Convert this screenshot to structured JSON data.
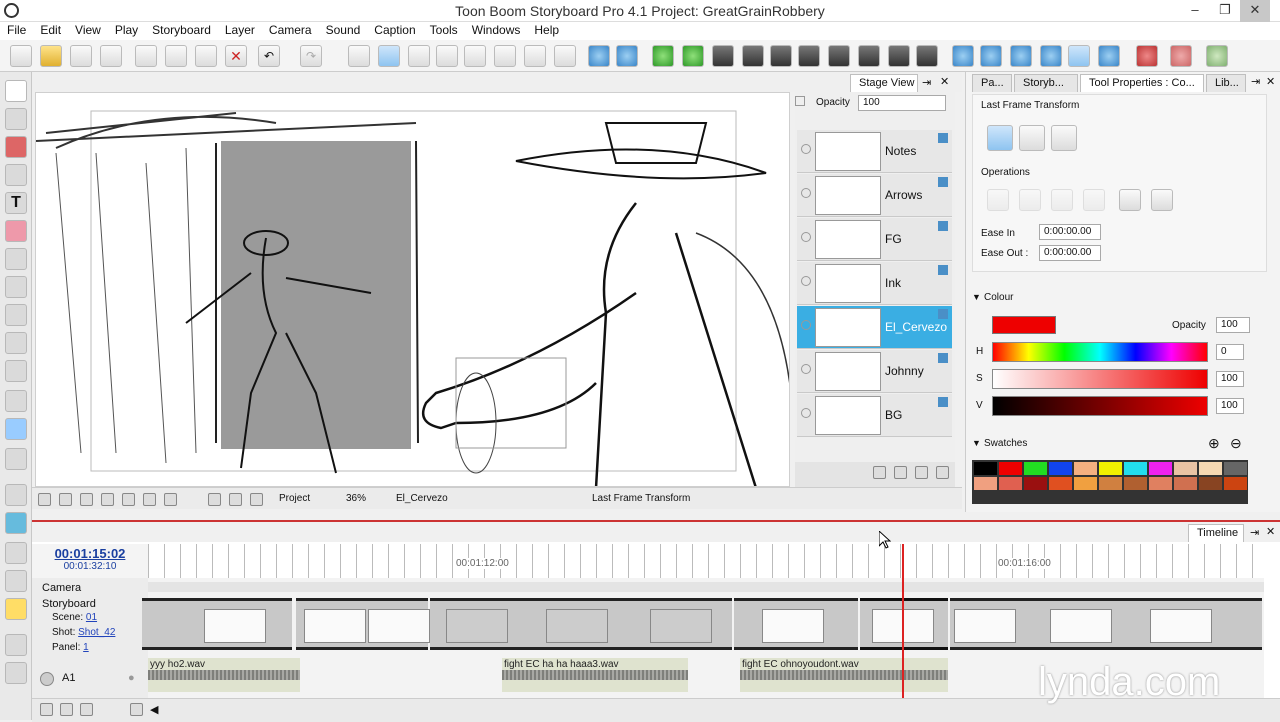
{
  "window": {
    "title": "Toon Boom Storyboard Pro 4.1 Project: GreatGrainRobbery"
  },
  "menu": [
    "File",
    "Edit",
    "View",
    "Play",
    "Storyboard",
    "Layer",
    "Camera",
    "Sound",
    "Caption",
    "Tools",
    "Windows",
    "Help"
  ],
  "stage": {
    "tab": "Stage View",
    "status": {
      "mode": "Project",
      "zoom": "36%",
      "layer": "El_Cervezo",
      "tool": "Last Frame Transform"
    }
  },
  "layers": {
    "opacity_label": "Opacity",
    "opacity_value": "100",
    "items": [
      {
        "name": "Notes"
      },
      {
        "name": "Arrows"
      },
      {
        "name": "FG"
      },
      {
        "name": "Ink"
      },
      {
        "name": "El_Cervezo",
        "selected": true
      },
      {
        "name": "Johnny"
      },
      {
        "name": "BG"
      }
    ]
  },
  "right_tabs": [
    "Pa...",
    "Storyb...",
    "Tool Properties : Co...",
    "Lib..."
  ],
  "tool_props": {
    "title": "Last Frame Transform",
    "operations_label": "Operations",
    "ease_in_label": "Ease In",
    "ease_in_value": "0:00:00.00",
    "ease_out_label": "Ease Out :",
    "ease_out_value": "0:00:00.00"
  },
  "colour": {
    "label": "Colour",
    "opacity_label": "Opacity",
    "opacity": "100",
    "h_label": "H",
    "h": "0",
    "s_label": "S",
    "s": "100",
    "v_label": "V",
    "v": "100",
    "current": "#ee0000"
  },
  "swatches": {
    "label": "Swatches",
    "colors": [
      "#000000",
      "#ee0000",
      "#22dd22",
      "#1144ee",
      "#f4b080",
      "#f0f000",
      "#22ddee",
      "#ee22ee",
      "#e9c3a4",
      "#f6d9b3",
      "#666666",
      "#f0a080",
      "#e06050",
      "#9a1010",
      "#e05020",
      "#f0a040",
      "#d08040",
      "#b06030",
      "#e08060",
      "#d07050",
      "#884422",
      "#cc4411"
    ]
  },
  "timeline": {
    "tab": "Timeline",
    "current_time": "00:01:15:02",
    "total_time": "00:01:32:10",
    "ruler": [
      "00:01:12:00",
      "00:01:16:00"
    ],
    "tracks": {
      "camera": "Camera",
      "storyboard": "Storyboard"
    },
    "scene_label": "Scene:",
    "scene": "01",
    "shot_label": "Shot:",
    "shot": "Shot_42",
    "panel_label": "Panel:",
    "panel": "1",
    "audio_track": "A1",
    "audio_clips": [
      "yyy ho2.wav",
      "fight EC ha ha haaa3.wav",
      "fight EC ohnoyoudont.wav"
    ]
  },
  "watermark": "lynda.com"
}
